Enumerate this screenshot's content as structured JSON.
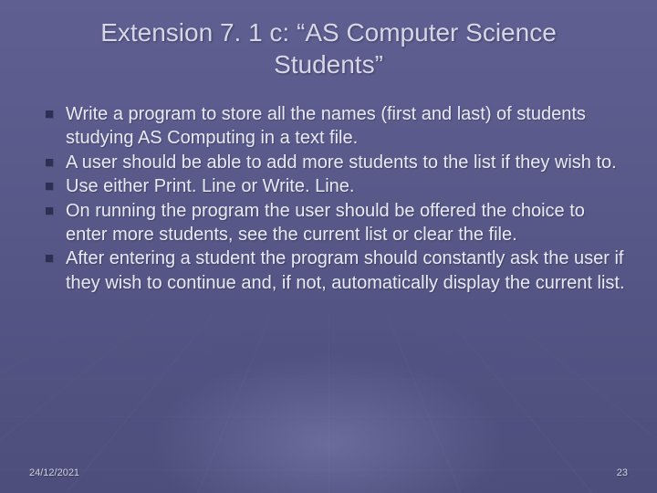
{
  "slide": {
    "title": "Extension 7. 1 c: “AS Computer Science Students”",
    "bullets": [
      "Write a program to store all the names (first and last) of students studying AS Computing in a text file.",
      "A user should be able to add more students to the list if they wish to.",
      "Use either Print. Line or Write. Line.",
      "On running the program the user should be offered the choice to enter more students, see the current list or clear the file.",
      "After entering a student the program should constantly ask the user if they wish to continue and, if not, automatically display the current list."
    ],
    "footer": {
      "date": "24/12/2021",
      "page": "23"
    }
  }
}
